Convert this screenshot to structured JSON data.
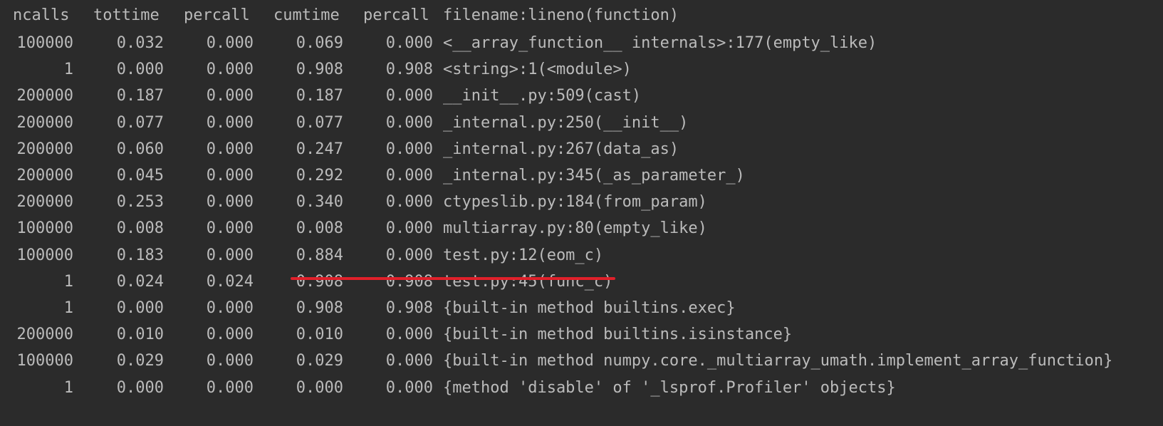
{
  "colors": {
    "background": "#2b2b2b",
    "text": "#bbbbbb",
    "annotation": "#e0202a"
  },
  "header": {
    "ncalls": "ncalls",
    "tottime": "tottime",
    "percall1": "percall",
    "cumtime": "cumtime",
    "percall2": "percall",
    "function": "filename:lineno(function)"
  },
  "rows": [
    {
      "ncalls": "100000",
      "tottime": "0.032",
      "percall1": "0.000",
      "cumtime": "0.069",
      "percall2": "0.000",
      "function": "<__array_function__ internals>:177(empty_like)"
    },
    {
      "ncalls": "1",
      "tottime": "0.000",
      "percall1": "0.000",
      "cumtime": "0.908",
      "percall2": "0.908",
      "function": "<string>:1(<module>)"
    },
    {
      "ncalls": "200000",
      "tottime": "0.187",
      "percall1": "0.000",
      "cumtime": "0.187",
      "percall2": "0.000",
      "function": "__init__.py:509(cast)"
    },
    {
      "ncalls": "200000",
      "tottime": "0.077",
      "percall1": "0.000",
      "cumtime": "0.077",
      "percall2": "0.000",
      "function": "_internal.py:250(__init__)"
    },
    {
      "ncalls": "200000",
      "tottime": "0.060",
      "percall1": "0.000",
      "cumtime": "0.247",
      "percall2": "0.000",
      "function": "_internal.py:267(data_as)"
    },
    {
      "ncalls": "200000",
      "tottime": "0.045",
      "percall1": "0.000",
      "cumtime": "0.292",
      "percall2": "0.000",
      "function": "_internal.py:345(_as_parameter_)"
    },
    {
      "ncalls": "200000",
      "tottime": "0.253",
      "percall1": "0.000",
      "cumtime": "0.340",
      "percall2": "0.000",
      "function": "ctypeslib.py:184(from_param)"
    },
    {
      "ncalls": "100000",
      "tottime": "0.008",
      "percall1": "0.000",
      "cumtime": "0.008",
      "percall2": "0.000",
      "function": "multiarray.py:80(empty_like)"
    },
    {
      "ncalls": "100000",
      "tottime": "0.183",
      "percall1": "0.000",
      "cumtime": "0.884",
      "percall2": "0.000",
      "function": "test.py:12(eom_c)"
    },
    {
      "ncalls": "1",
      "tottime": "0.024",
      "percall1": "0.024",
      "cumtime": "0.908",
      "percall2": "0.908",
      "function": "test.py:45(func_c)"
    },
    {
      "ncalls": "1",
      "tottime": "0.000",
      "percall1": "0.000",
      "cumtime": "0.908",
      "percall2": "0.908",
      "function": "{built-in method builtins.exec}"
    },
    {
      "ncalls": "200000",
      "tottime": "0.010",
      "percall1": "0.000",
      "cumtime": "0.010",
      "percall2": "0.000",
      "function": "{built-in method builtins.isinstance}"
    },
    {
      "ncalls": "100000",
      "tottime": "0.029",
      "percall1": "0.000",
      "cumtime": "0.029",
      "percall2": "0.000",
      "function": "{built-in method numpy.core._multiarray_umath.implement_array_function}"
    },
    {
      "ncalls": "1",
      "tottime": "0.000",
      "percall1": "0.000",
      "cumtime": "0.000",
      "percall2": "0.000",
      "function": "{method 'disable' of '_lsprof.Profiler' objects}"
    }
  ]
}
